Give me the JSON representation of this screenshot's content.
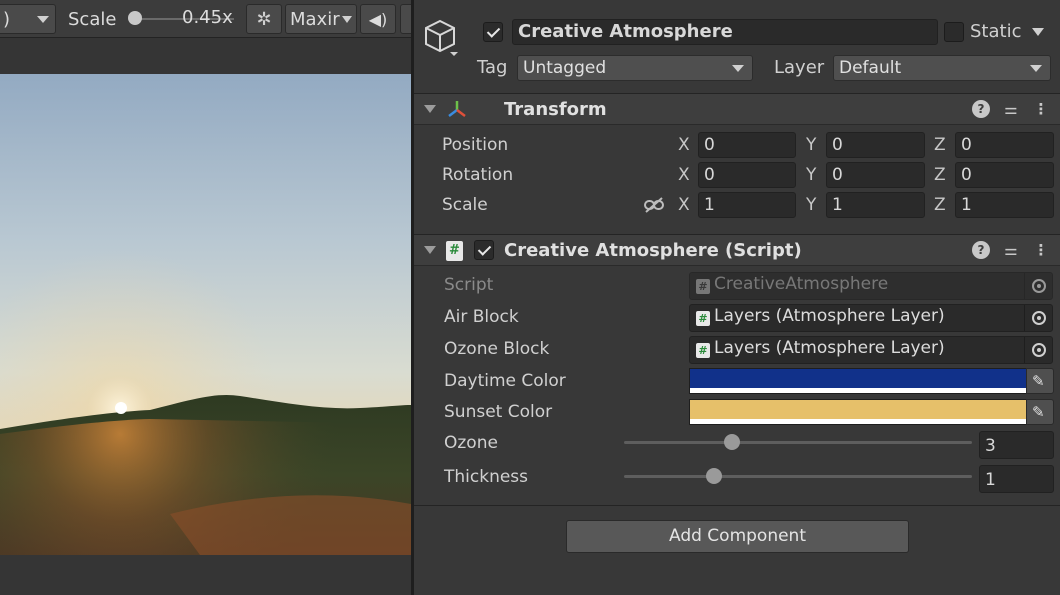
{
  "game_toolbar": {
    "display_partial": ")",
    "scale_label": "Scale",
    "scale_value": "0.45x",
    "scale_level": 0.0,
    "maximize_label": "Maxir"
  },
  "object": {
    "name": "Creative Atmosphere",
    "active": true,
    "static_label": "Static",
    "static_checked": false,
    "tag_label": "Tag",
    "tag_value": "Untagged",
    "layer_label": "Layer",
    "layer_value": "Default"
  },
  "transform": {
    "title": "Transform",
    "rows": [
      {
        "label": "Position",
        "x": "0",
        "y": "0",
        "z": "0"
      },
      {
        "label": "Rotation",
        "x": "0",
        "y": "0",
        "z": "0"
      },
      {
        "label": "Scale",
        "x": "1",
        "y": "1",
        "z": "1"
      }
    ],
    "axis_x": "X",
    "axis_y": "Y",
    "axis_z": "Z"
  },
  "script_component": {
    "title": "Creative Atmosphere (Script)",
    "enabled": true,
    "script_label": "Script",
    "script_value": "CreativeAtmosphere",
    "air_block_label": "Air Block",
    "air_block_value": "Layers (Atmosphere Layer)",
    "ozone_block_label": "Ozone Block",
    "ozone_block_value": "Layers (Atmosphere Layer)",
    "daytime_color_label": "Daytime Color",
    "daytime_color": "#11318a",
    "sunset_color_label": "Sunset Color",
    "sunset_color": "#e6c06a",
    "ozone_label": "Ozone",
    "ozone_value": "3",
    "ozone_level": 0.31,
    "thickness_label": "Thickness",
    "thickness_value": "1",
    "thickness_level": 0.26
  },
  "add_component_label": "Add Component",
  "colors": {
    "panel": "#383838",
    "field": "#2a2a2a",
    "header": "#3e3e3e"
  }
}
